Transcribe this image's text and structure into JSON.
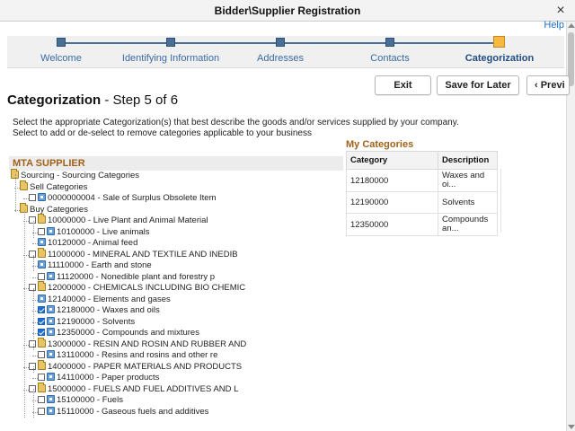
{
  "window": {
    "title": "Bidder\\Supplier Registration",
    "close_label": "×"
  },
  "help_label": "Help",
  "steps": [
    {
      "label": "Welcome"
    },
    {
      "label": "Identifying Information"
    },
    {
      "label": "Addresses"
    },
    {
      "label": "Contacts"
    },
    {
      "label": "Categorization",
      "active": true
    }
  ],
  "buttons": {
    "exit": "Exit",
    "save_later": "Save for Later",
    "previous": "‹ Previ"
  },
  "page": {
    "title": "Categorization",
    "subtitle": " - Step 5 of 6",
    "instructions_line1": "Select the appropriate Categorization(s) that best describe the goods and/or services supplied by your company.",
    "instructions_line2": "Select to add or de-select to remove categories applicable to your business"
  },
  "my_categories": {
    "heading": "My Categories",
    "columns": [
      "Category",
      "Description"
    ],
    "rows": [
      {
        "category": "12180000",
        "description": "Waxes and oi..."
      },
      {
        "category": "12190000",
        "description": "Solvents"
      },
      {
        "category": "12350000",
        "description": "Compounds an..."
      }
    ]
  },
  "tree": {
    "heading": "MTA SUPPLIER",
    "nodes": [
      {
        "label": "Sourcing - Sourcing Categories",
        "checkbox": false,
        "icon": "folder"
      },
      {
        "label": "Sell Categories",
        "checkbox": false,
        "icon": "folder"
      },
      {
        "label": "0000000004 - Sale of Surplus Obsolete Item",
        "checkbox": true,
        "checked": false,
        "icon": "leaf"
      },
      {
        "label": "Buy Categories",
        "checkbox": false,
        "icon": "folder"
      },
      {
        "label": "10000000 - Live Plant and Animal Material",
        "checkbox": true,
        "checked": false,
        "icon": "folder"
      },
      {
        "label": "10100000 - Live animals",
        "checkbox": true,
        "checked": false,
        "icon": "leaf"
      },
      {
        "label": "10120000 - Animal feed",
        "checkbox": false,
        "icon": "leaf"
      },
      {
        "label": "11000000 - MINERAL AND TEXTILE AND INEDIB",
        "checkbox": true,
        "checked": false,
        "icon": "folder"
      },
      {
        "label": "11110000 - Earth and stone",
        "checkbox": false,
        "icon": "leaf"
      },
      {
        "label": "11120000 - Nonedible plant and forestry p",
        "checkbox": true,
        "checked": false,
        "icon": "leaf"
      },
      {
        "label": "12000000 - CHEMICALS INCLUDING BIO CHEMIC",
        "checkbox": true,
        "checked": false,
        "icon": "folder"
      },
      {
        "label": "12140000 - Elements and gases",
        "checkbox": false,
        "icon": "leaf"
      },
      {
        "label": "12180000 - Waxes and oils",
        "checkbox": true,
        "checked": true,
        "icon": "leaf"
      },
      {
        "label": "12190000 - Solvents",
        "checkbox": true,
        "checked": true,
        "icon": "leaf"
      },
      {
        "label": "12350000 - Compounds and mixtures",
        "checkbox": true,
        "checked": true,
        "icon": "leaf"
      },
      {
        "label": "13000000 - RESIN AND ROSIN AND RUBBER AND",
        "checkbox": true,
        "checked": false,
        "icon": "folder"
      },
      {
        "label": "13110000 - Resins and rosins and other re",
        "checkbox": true,
        "checked": false,
        "icon": "leaf"
      },
      {
        "label": "14000000 - PAPER MATERIALS AND PRODUCTS",
        "checkbox": true,
        "checked": false,
        "icon": "folder"
      },
      {
        "label": "14110000 - Paper products",
        "checkbox": true,
        "checked": false,
        "icon": "leaf"
      },
      {
        "label": "15000000 - FUELS AND FUEL ADDITIVES AND L",
        "checkbox": true,
        "checked": false,
        "icon": "folder"
      },
      {
        "label": "15100000 - Fuels",
        "checkbox": true,
        "checked": false,
        "icon": "leaf"
      },
      {
        "label": "15110000 - Gaseous fuels and additives",
        "checkbox": true,
        "checked": false,
        "icon": "leaf"
      }
    ]
  }
}
